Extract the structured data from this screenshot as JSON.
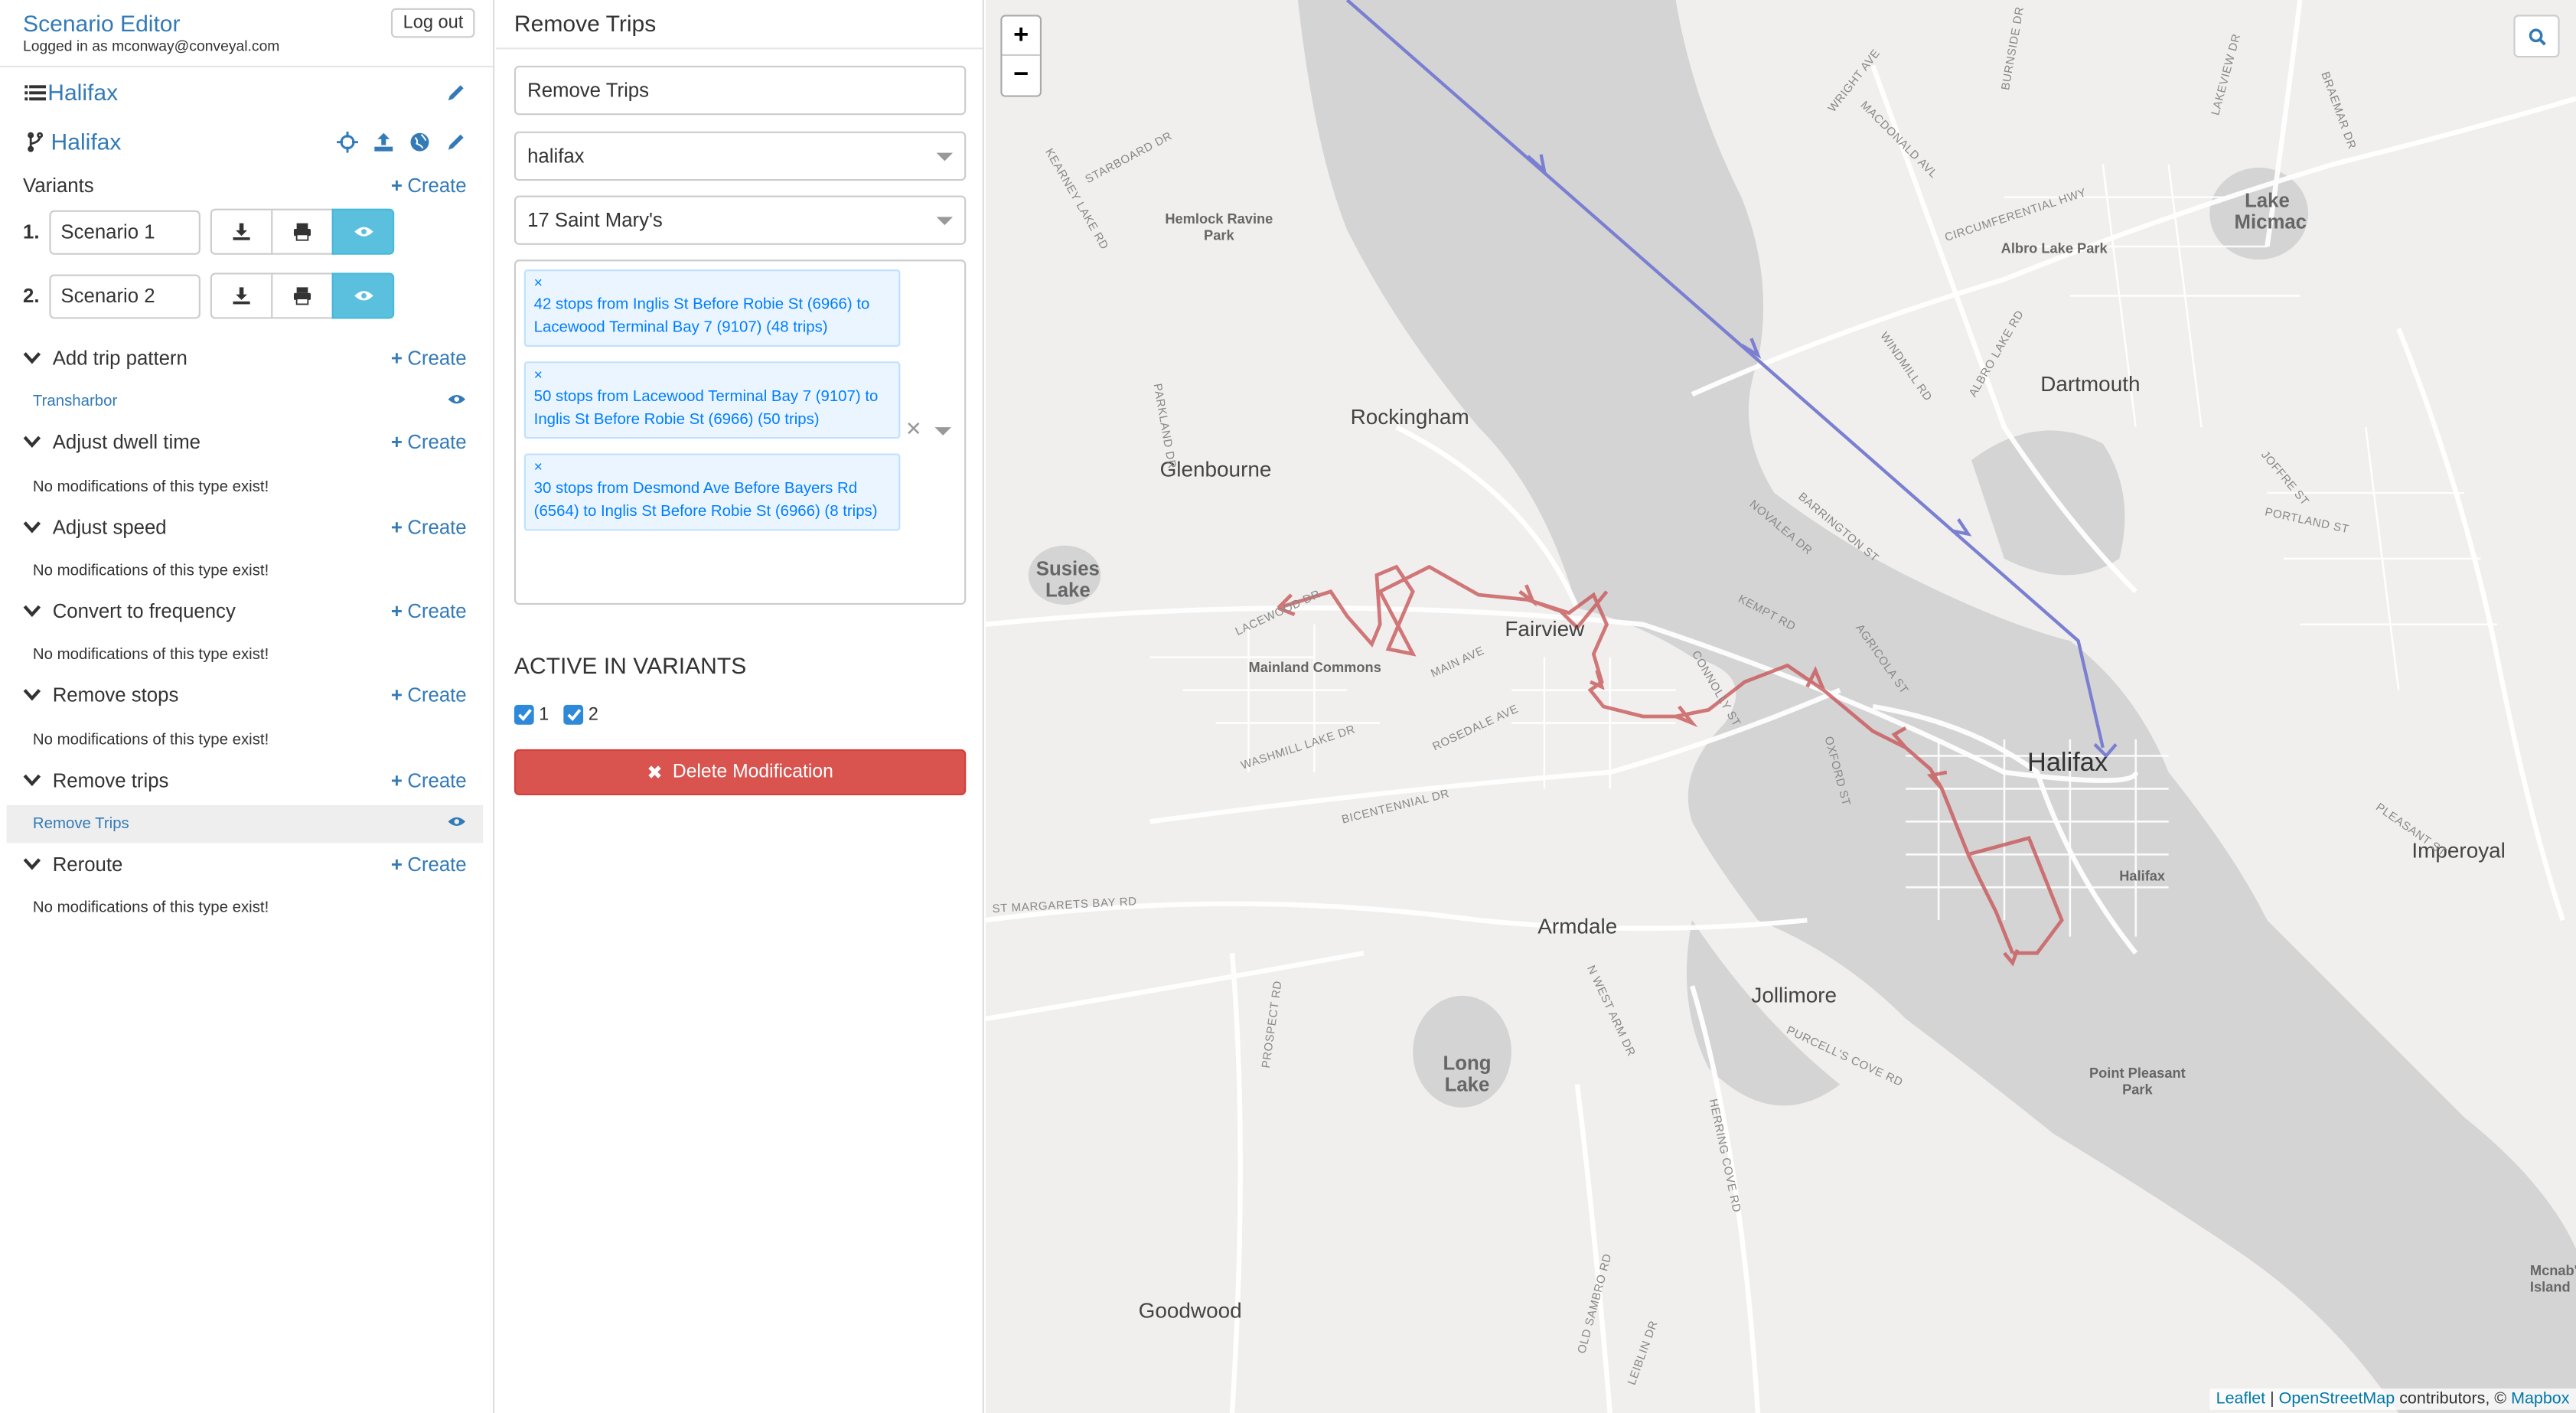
{
  "header": {
    "app_title": "Scenario Editor",
    "logged_in": "Logged in as mconway@conveyal.com",
    "logout": "Log out"
  },
  "region": {
    "name": "Halifax"
  },
  "project": {
    "name": "Halifax"
  },
  "variants": {
    "label": "Variants",
    "create": "Create",
    "items": [
      {
        "num": "1.",
        "name": "Scenario 1"
      },
      {
        "num": "2.",
        "name": "Scenario 2"
      }
    ]
  },
  "sections": [
    {
      "title": "Add trip pattern",
      "create": "Create",
      "item": "Transharbor"
    },
    {
      "title": "Adjust dwell time",
      "create": "Create",
      "note": "No modifications of this type exist!"
    },
    {
      "title": "Adjust speed",
      "create": "Create",
      "note": "No modifications of this type exist!"
    },
    {
      "title": "Convert to frequency",
      "create": "Create",
      "note": "No modifications of this type exist!"
    },
    {
      "title": "Remove stops",
      "create": "Create",
      "note": "No modifications of this type exist!"
    },
    {
      "title": "Remove trips",
      "create": "Create",
      "item": "Remove Trips"
    },
    {
      "title": "Reroute",
      "create": "Create",
      "note": "No modifications of this type exist!"
    }
  ],
  "panel": {
    "title": "Remove Trips",
    "name_value": "Remove Trips",
    "feed": "halifax",
    "route": "17 Saint Mary's",
    "patterns": [
      "42 stops from Inglis St Before Robie St (6966) to Lacewood Terminal Bay 7 (9107) (48 trips)",
      "50 stops from Lacewood Terminal Bay 7 (9107) to Inglis St Before Robie St (6966) (50 trips)",
      "30 stops from Desmond Ave Before Bayers Rd (6564) to Inglis St Before Robie St (6966) (8 trips)"
    ],
    "tag_remove": "×",
    "clear": "✕",
    "active_heading": "ACTIVE IN VARIANTS",
    "variant_checks": [
      "1",
      "2"
    ],
    "delete": "Delete Modification"
  },
  "map": {
    "zoom_in": "+",
    "zoom_out": "−",
    "places": [
      "Rockingham",
      "Glenbourne",
      "Susies Lake",
      "Fairview",
      "Mainland Commons",
      "Hemlock Ravine Park",
      "Lake Micmac",
      "Albro Lake Park",
      "Dartmouth",
      "Halifax",
      "Armdale",
      "Jollimore",
      "Long Lake",
      "Point Pleasant Park",
      "Imperoyal",
      "Goodwood",
      "Halifax",
      "Mcnab's Island"
    ],
    "roads": [
      "STARBOARD DR",
      "KEARNEY LAKE RD",
      "WRIGHT AVE",
      "MACDONALD AVL",
      "CIRCUMFERENTIAL HWY",
      "WINDMILL RD",
      "ALBRO LAKE RD",
      "NOVALEA DR",
      "BARRINGTON ST",
      "KEMPT RD",
      "AGRICOLA ST",
      "CONNOLLY ST",
      "OXFORD ST",
      "MAIN AVE",
      "ROSEDALE AVE",
      "WASHMILL LAKE DR",
      "BICENTENNIAL DR",
      "ST MARGARETS BAY RD",
      "PROSPECT RD",
      "PURCELL'S COVE RD",
      "HERRING COVE RD",
      "JOFFRE ST",
      "PORTLAND ST",
      "PLEASANT ST",
      "BRAEMAR DR",
      "LAKEVIEW DR",
      "BURNSIDE DR",
      "PARKLAND DR",
      "LACEWOOD DR",
      "N WEST ARM DR",
      "OLD SAMBRO RD",
      "LEIBLIN DR"
    ],
    "attribution": {
      "leaflet": "Leaflet",
      "osm": "OpenStreetMap",
      "contributors": "contributors, ©",
      "mapbox": "Mapbox"
    }
  },
  "colors": {
    "link": "#337ab7",
    "info": "#5bc0de",
    "danger": "#d9534f",
    "route_removed": "#c9585a",
    "route_added": "#7b7fd1",
    "water": "#cfcfcf",
    "land": "#f0efed"
  }
}
